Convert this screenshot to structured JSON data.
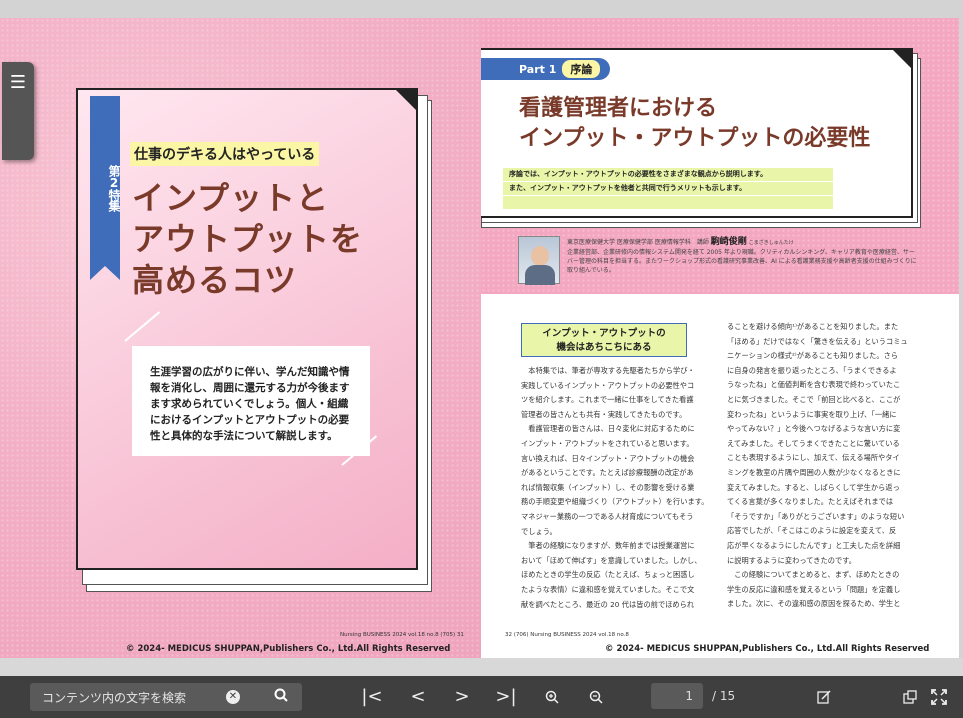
{
  "left_page": {
    "feature_label": "第2特集",
    "subtitle": "仕事のデキる人はやっている",
    "title_lines": [
      "インプットと",
      "アウトプットを",
      "高めるコツ"
    ],
    "description": "生涯学習の広がりに伴い、学んだ知識や情報を消化し、周囲に還元する力が今後ますます求められていくでしょう。個人・組織におけるインプットとアウトプットの必要性と具体的な手法について解説します。",
    "page_footer": "Nursing BUSINESS 2024 vol.18 no.8 (705) 31",
    "copyright": "© 2024- MEDICUS SHUPPAN,Publishers Co., Ltd.All Rights Reserved"
  },
  "right_page": {
    "part_label": "Part 1",
    "part_tag": "序論",
    "title_lines": [
      "看護管理者における",
      "インプット・アウトプットの必要性"
    ],
    "intro_lines": [
      "序論では、インプット・アウトプットの必要性をさまざまな観点から説明します。",
      "また、インプット・アウトプットを他者と共同で行うメリットも示します。",
      ""
    ],
    "author_affiliation": "東京医療保健大学 医療保健学部 医療情報学科　講師",
    "author_name": "駒崎俊剛",
    "author_ruby": "こまざきしゅんたけ",
    "author_bio": "企業経営部、企業研修内の情報システム開発を経て 2005 年より現職。クリティカルシンキング、キャリア教育や医療経営、サーバー管理の科目を担当する。またワークショップ形式の看護研究事業改善、AI による看護業務支援や高齢者支援の仕組みづくりに取り組んでいる。",
    "section_heading_1": "インプット・アウトプットの",
    "section_heading_2": "機会はあちこちにある",
    "col1_lines": [
      "　本特集では、筆者が専攻する先駆者たちから学び・",
      "実践しているインプット・アウトプットの必要性やコ",
      "ツを紹介します。これまで一緒に仕事をしてきた看護",
      "管理者の皆さんとも共有・実践してきたものです。",
      "　看護管理者の皆さんは、日々変化に対応するために",
      "インプット・アウトプットをされていると思います。",
      "言い換えれば、日々インプット・アウトプットの機会",
      "があるということです。たとえば診療報酬の改定があ",
      "れば情報収集（インプット）し、その影響を受ける業",
      "務の手順変更や組織づくり（アウトプット）を行います。",
      "マネジャー業務の一つである人材育成についてもそう",
      "でしょう。",
      "　筆者の経験になりますが、数年前までは授業運営に",
      "おいて「ほめて伸ばす」を意識していました。しかし、",
      "ほめたときの学生の反応（たとえば、ちょっと困惑し",
      "たような表情）に違和感を覚えていました。そこで文",
      "献を調べたところ、最近の 20 代は皆の前でほめられ"
    ],
    "col2_lines": [
      "ることを避ける傾向¹⁾があることを知りました。また",
      "「ほめる」だけではなく「驚きを伝える」というコミュ",
      "ニケーションの様式²⁾があることも知りました。さら",
      "に自身の発言を振り返ったところ、「うまくできるよ",
      "うなったね」と価値判断を含む表現で終わっていたこ",
      "とに気づきました。そこで「前回と比べると、ここが",
      "変わったね」というように事実を取り上げ、「一緒に",
      "やってみない？」と今後へつなげるような言い方に変",
      "えてみました。そしてうまくできたことに驚いている",
      "ことも表現するようにし、加えて、伝える場所やタイ",
      "ミングを教室の片隅や周囲の人数が少なくなるときに",
      "変えてみました。すると、しばらくして学生から返っ",
      "てくる言葉が多くなりました。たとえばそれまでは",
      "「そうですか」「ありがとうございます」のような短い",
      "応答でしたが、「そこはこのように設定を変えて、反",
      "応が早くなるようにしたんです」と工夫した点を詳細",
      "に説明するように変わってきたのです。",
      "　この経験についてまとめると、まず、ほめたときの",
      "学生の反応に違和感を覚えるという「問題」を定義し",
      "ました。次に、その違和感の原因を探るため、学生と"
    ],
    "page_footer": "32 (706)  Nursing BUSINESS 2024 vol.18 no.8",
    "copyright": "© 2024- MEDICUS SHUPPAN,Publishers Co., Ltd.All Rights Reserved"
  },
  "toolbar": {
    "search_placeholder": "コンテンツ内の文字を検索",
    "current_page": "1",
    "total_pages": "/ 15"
  },
  "icons": {
    "menu": "list-icon",
    "clear": "clear-icon",
    "search": "search-icon",
    "first": "first-page-icon",
    "prev": "prev-page-icon",
    "next": "next-page-icon",
    "last": "last-page-icon",
    "zoom_in": "zoom-in-icon",
    "zoom_out": "zoom-out-icon",
    "note": "edit-note-icon",
    "share": "share-icon",
    "fullscreen": "fullscreen-icon"
  },
  "colors": {
    "toolbar": "#3f3f3f",
    "accent_blue": "#3f6dba",
    "title_brown": "#7a3a2a",
    "highlight_yellow": "#fbf6a5"
  }
}
